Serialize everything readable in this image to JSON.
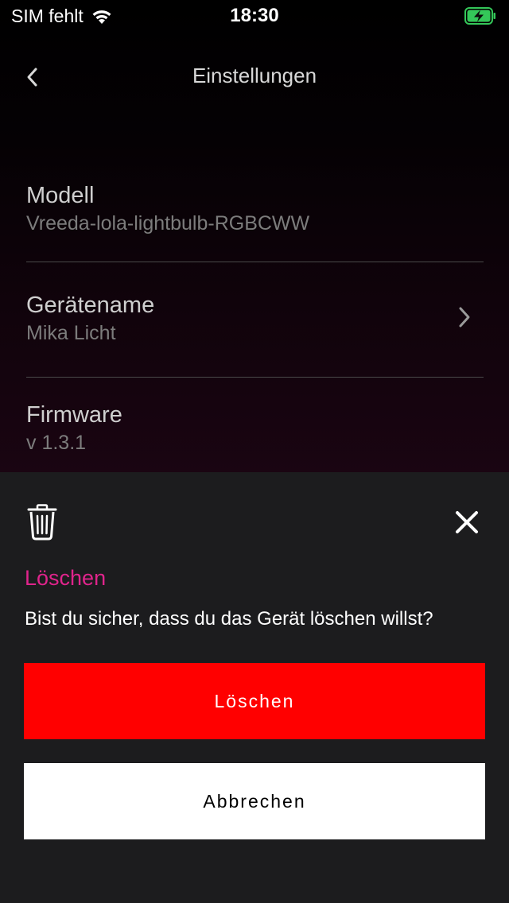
{
  "status_bar": {
    "carrier": "SIM fehlt",
    "time": "18:30",
    "wifi_icon": "wifi-icon",
    "battery_icon": "battery-charging-icon",
    "battery_color": "#34c759"
  },
  "nav": {
    "title": "Einstellungen",
    "back_icon": "chevron-left-icon"
  },
  "settings": {
    "model": {
      "label": "Modell",
      "value": "Vreeda-lola-lightbulb-RGBCWW"
    },
    "device_name": {
      "label": "Gerätename",
      "value": "Mika Licht"
    },
    "firmware": {
      "label": "Firmware",
      "value": "v 1.3.1"
    }
  },
  "dialog": {
    "icon": "trash-icon",
    "close_icon": "close-icon",
    "title": "Löschen",
    "message": "Bist du sicher, dass du das Gerät löschen willst?",
    "confirm_label": "Löschen",
    "cancel_label": "Abbrechen",
    "accent_color": "#e0248c",
    "danger_color": "#ff0000"
  }
}
